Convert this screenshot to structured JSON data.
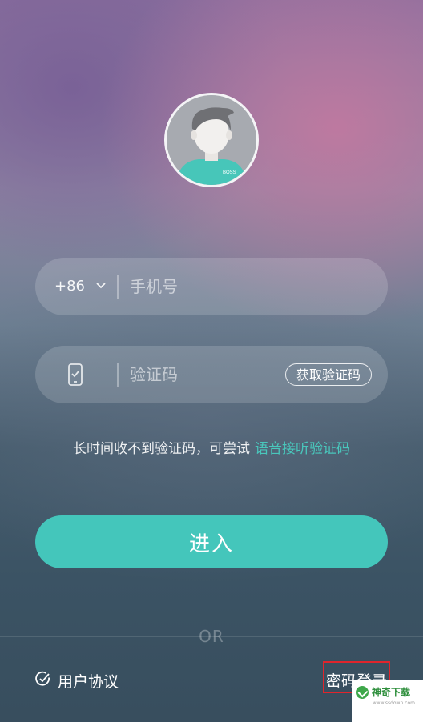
{
  "avatar": {
    "badge_text": "BOSS"
  },
  "phone_field": {
    "country_code": "+86",
    "placeholder": "手机号"
  },
  "code_field": {
    "placeholder": "验证码",
    "get_code_label": "获取验证码"
  },
  "hint": {
    "text": "长时间收不到验证码，可尝试",
    "voice_link": "语音接听验证码"
  },
  "enter_button": {
    "label": "进入"
  },
  "separator": {
    "text": "OR"
  },
  "footer": {
    "agreement_label": "用户协议",
    "password_login_label": "密码登录"
  },
  "watermark": {
    "text": "神奇下载",
    "sub": "www.ssdown.com"
  },
  "colors": {
    "accent": "#44c6bb",
    "link": "#49c7bc",
    "highlight_box": "#e0252c"
  }
}
